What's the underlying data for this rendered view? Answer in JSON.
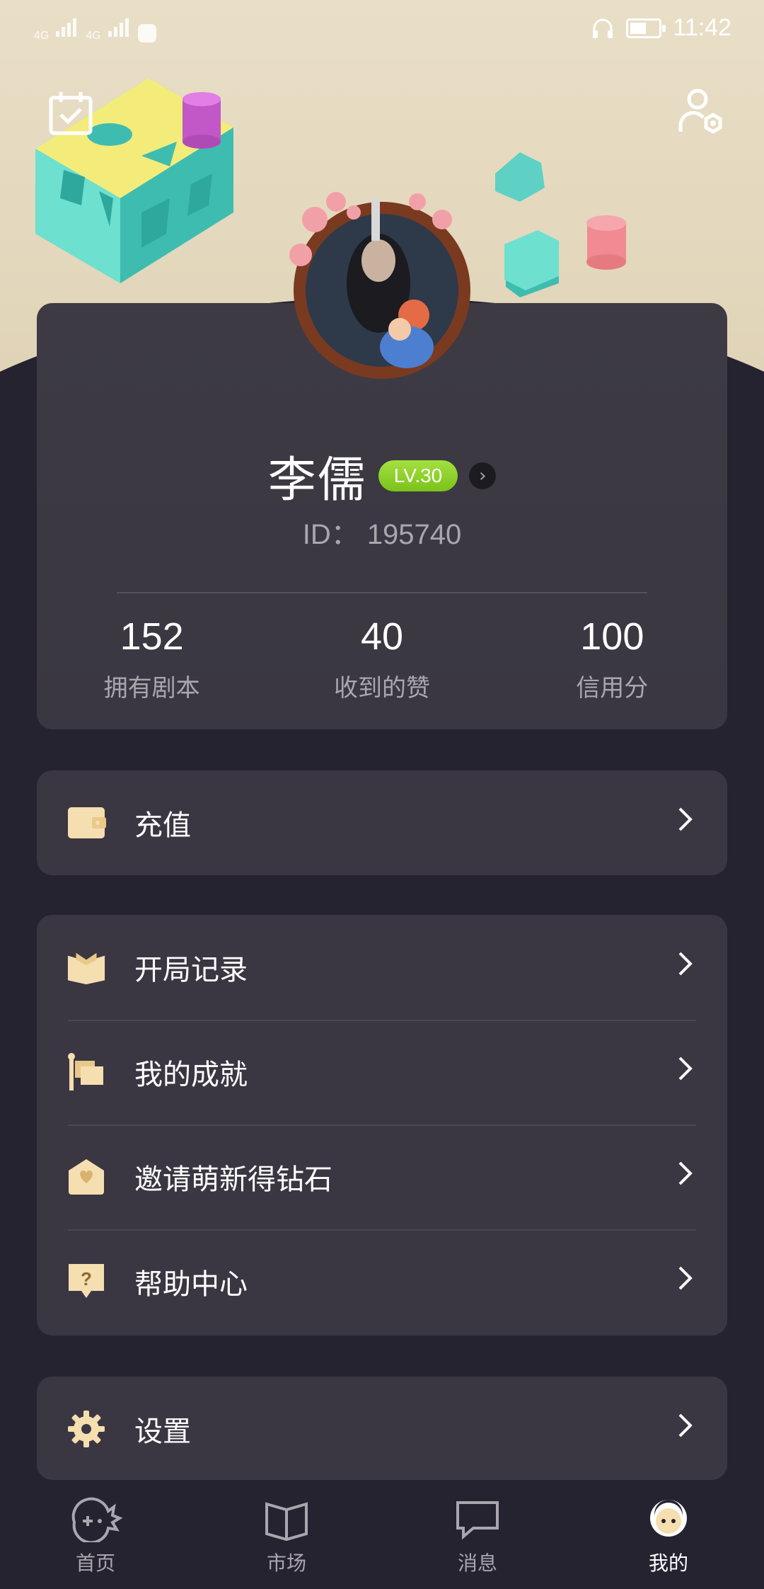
{
  "status_bar": {
    "time": "11:42",
    "net1": "4G",
    "net2": "4G"
  },
  "profile": {
    "name": "李儒",
    "level": "LV.30",
    "id_text": "ID： 195740",
    "stats": [
      {
        "value": "152",
        "label": "拥有剧本"
      },
      {
        "value": "40",
        "label": "收到的赞"
      },
      {
        "value": "100",
        "label": "信用分"
      }
    ]
  },
  "menu": {
    "recharge": "充值",
    "group2": [
      "开局记录",
      "我的成就",
      "邀请萌新得钻石",
      "帮助中心"
    ],
    "settings": "设置",
    "chevron": ">"
  },
  "nav": {
    "items": [
      "首页",
      "市场",
      "消息",
      "我的"
    ],
    "active_index": 3
  },
  "colors": {
    "accent": "#f5deb0",
    "level_green": "#8fd12b",
    "card": "#3a3742",
    "bg": "#252330"
  }
}
